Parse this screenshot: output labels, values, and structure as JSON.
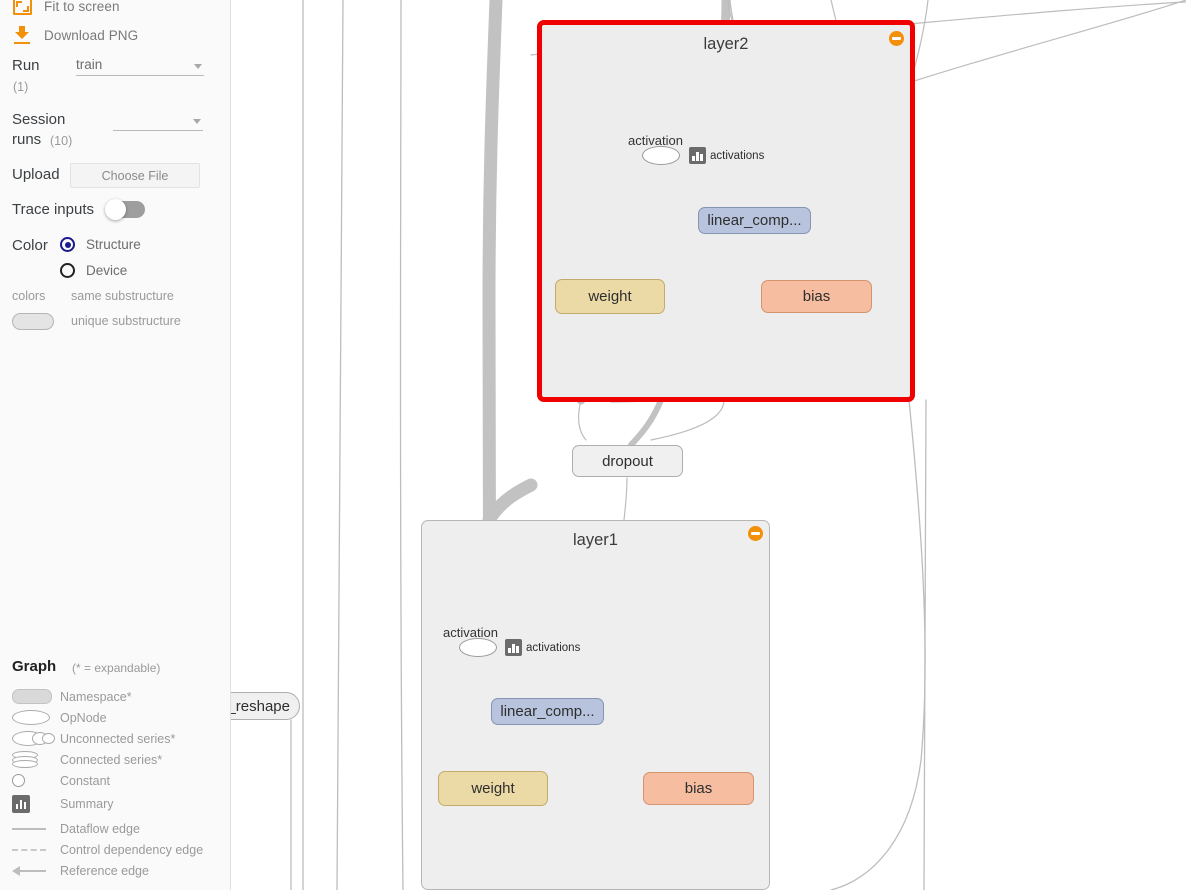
{
  "sidebar": {
    "actions": [
      {
        "label": "Fit to screen",
        "icon": "fit-to-screen-icon"
      },
      {
        "label": "Download PNG",
        "icon": "download-icon"
      }
    ],
    "run": {
      "label": "Run",
      "count": "(1)",
      "value": "train",
      "caret": "chevron-down-icon"
    },
    "session_runs": {
      "label": "Session",
      "label2": "runs",
      "count": "(10)",
      "value": "",
      "caret": "chevron-down-icon"
    },
    "upload": {
      "label": "Upload",
      "button_label": "Choose File"
    },
    "trace_inputs": {
      "label": "Trace inputs",
      "state": "off"
    },
    "color": {
      "label": "Color",
      "options": [
        {
          "label": "Structure",
          "selected": true
        },
        {
          "label": "Device",
          "selected": false
        }
      ],
      "colors_label": "colors",
      "same_substructure": "same substructure",
      "unique_substructure": "unique substructure"
    },
    "legend": {
      "title": "Graph",
      "note": "(* = expandable)",
      "items": [
        {
          "label": "Namespace*",
          "symbol": "namespace-symbol"
        },
        {
          "label": "OpNode",
          "symbol": "opnode-symbol"
        },
        {
          "label": "Unconnected series*",
          "symbol": "unconnected-series-symbol"
        },
        {
          "label": "Connected series*",
          "symbol": "connected-series-symbol"
        },
        {
          "label": "Constant",
          "symbol": "constant-symbol"
        },
        {
          "label": "Summary",
          "symbol": "summary-symbol"
        },
        {
          "label": "Dataflow edge",
          "symbol": "dataflow-edge-symbol"
        },
        {
          "label": "Control dependency edge",
          "symbol": "control-dependency-edge-symbol"
        },
        {
          "label": "Reference edge",
          "symbol": "reference-edge-symbol"
        }
      ]
    }
  },
  "graph": {
    "selected_color": "#f00000",
    "groups": [
      {
        "id": "layer2",
        "title": "layer2",
        "selected": true,
        "activation_label": "activation",
        "summary_label": "activations",
        "linear_label": "linear_comp...",
        "weight_label": "weight",
        "bias_label": "bias"
      },
      {
        "id": "layer1",
        "title": "layer1",
        "selected": false,
        "activation_label": "activation",
        "summary_label": "activations",
        "linear_label": "linear_comp...",
        "weight_label": "weight",
        "bias_label": "bias"
      }
    ],
    "nodes": [
      {
        "id": "dropout",
        "label": "dropout"
      },
      {
        "id": "reshape",
        "label": "_reshape"
      }
    ]
  }
}
